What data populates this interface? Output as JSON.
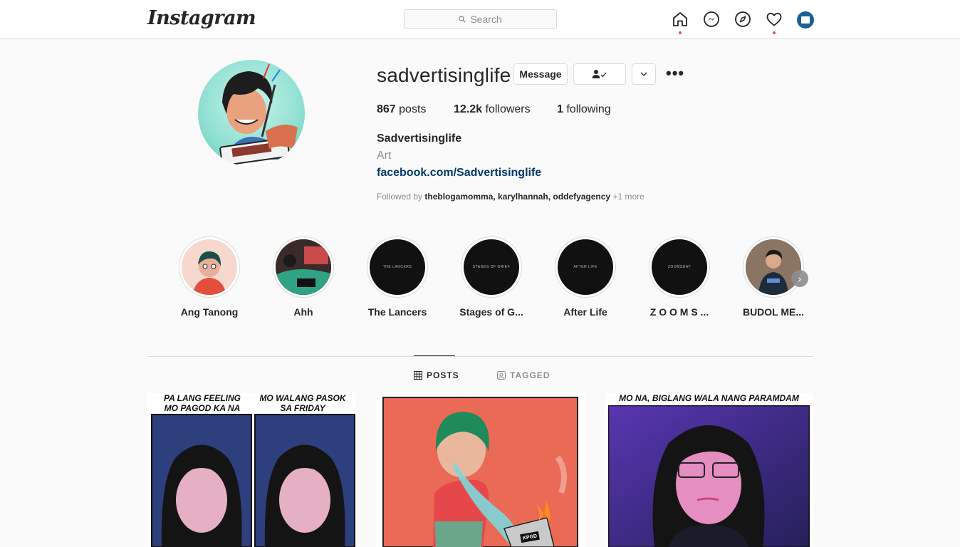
{
  "nav": {
    "logo": "Instagram",
    "search_placeholder": "Search",
    "icons": [
      "home-icon",
      "messenger-icon",
      "explore-icon",
      "heart-icon",
      "profile-avatar"
    ]
  },
  "profile": {
    "username": "sadvertisinglife",
    "message_label": "Message",
    "stats": {
      "posts_count": "867",
      "posts_label": "posts",
      "followers_count": "12.2k",
      "followers_label": "followers",
      "following_count": "1",
      "following_label": "following"
    },
    "full_name": "Sadvertisinglife",
    "category": "Art",
    "link": "facebook.com/Sadvertisinglife",
    "followed_by_prefix": "Followed by",
    "followed_by_names": "theblogamomma, karylhannah, oddefyagency",
    "followed_by_more": "+1 more"
  },
  "highlights": [
    {
      "label": "Ang Tanong",
      "cover_text": ""
    },
    {
      "label": "Ahh",
      "cover_text": ""
    },
    {
      "label": "The Lancers",
      "cover_text": "THE LANCERS"
    },
    {
      "label": "Stages of G...",
      "cover_text": "STAGES OF GRIEF"
    },
    {
      "label": "After Life",
      "cover_text": "AFTER LIFE"
    },
    {
      "label": "Z O O M S ...",
      "cover_text": "ZOOMSDAY"
    },
    {
      "label": "BUDOL ME...",
      "cover_text": ""
    }
  ],
  "tabs": {
    "posts": "POSTS",
    "tagged": "TAGGED"
  },
  "posts": [
    {
      "caption_left": "PA LANG FEELING MO PAGOD KA NA",
      "caption_right": "MO WALANG PASOK SA FRIDAY"
    },
    {
      "laptop_label": "KPGD"
    },
    {
      "caption": "MO NA, BIGLANG WALA NANG PARAMDAM"
    }
  ],
  "colors": {
    "link": "#00376b",
    "notification_dot": "#ed4956",
    "border": "#dbdbdb",
    "secondary_text": "#8e8e8e"
  }
}
